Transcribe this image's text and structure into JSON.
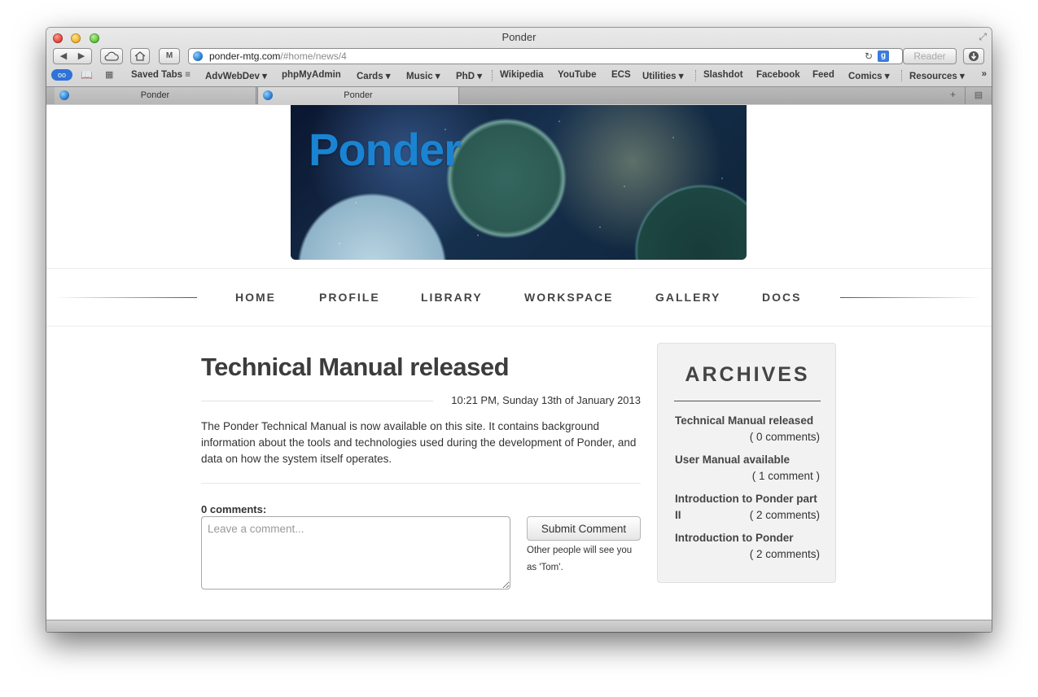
{
  "window": {
    "title": "Ponder"
  },
  "toolbar": {
    "back": "◀",
    "forward": "▶",
    "icloud_icon": "cloud-icon",
    "home_icon": "home-icon",
    "top_sites_label": "M",
    "url_host": "ponder-mtg.com",
    "url_path": "/#home/news/4",
    "reload_icon": "↻",
    "search_engine": "g",
    "reader_label": "Reader"
  },
  "bookmarks": [
    {
      "label": "Saved Tabs ≡"
    },
    {
      "label": "AdvWebDev ▾"
    },
    {
      "label": "phpMyAdmin"
    },
    {
      "label": "Cards ▾"
    },
    {
      "label": "Music ▾"
    },
    {
      "label": "PhD ▾"
    },
    {
      "label": "Wikipedia"
    },
    {
      "label": "YouTube"
    },
    {
      "label": "ECS"
    },
    {
      "label": "Utilities ▾"
    },
    {
      "label": "Slashdot"
    },
    {
      "label": "Facebook"
    },
    {
      "label": "Feed"
    },
    {
      "label": "Comics ▾"
    },
    {
      "label": "Resources ▾"
    }
  ],
  "bookmarks_more": "»",
  "tabs": [
    {
      "label": "Ponder"
    },
    {
      "label": "Ponder"
    }
  ],
  "banner": {
    "logo_text": "Ponder"
  },
  "nav": [
    {
      "label": "HOME"
    },
    {
      "label": "PROFILE"
    },
    {
      "label": "LIBRARY"
    },
    {
      "label": "WORKSPACE"
    },
    {
      "label": "GALLERY"
    },
    {
      "label": "DOCS"
    }
  ],
  "post": {
    "title": "Technical Manual released",
    "date": "10:21 PM, Sunday 13th of January 2013",
    "body": "The Ponder Technical Manual is now available on this site. It contains background information about the tools and technologies used during the development of Ponder, and data on how the system itself operates.",
    "comments_label": "0 comments:",
    "comment_placeholder": "Leave a comment...",
    "submit_label": "Submit Comment",
    "submit_note": "Other people will see you as 'Tom'."
  },
  "archives": {
    "title": "ARCHIVES",
    "items": [
      {
        "title": "Technical Manual released",
        "count": "( 0 comments)"
      },
      {
        "title": "User Manual available",
        "count": "( 1 comment )"
      },
      {
        "title": "Introduction to Ponder part II",
        "count": "( 2 comments)"
      },
      {
        "title": "Introduction to Ponder",
        "count": "( 2 comments)"
      }
    ]
  }
}
